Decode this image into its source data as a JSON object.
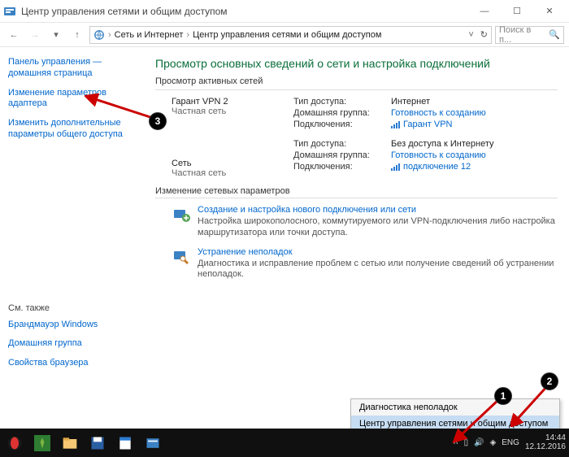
{
  "window": {
    "title": "Центр управления сетями и общим доступом",
    "min": "—",
    "max": "☐",
    "close": "✕"
  },
  "nav": {
    "back": "←",
    "forward": "→",
    "up": "↑",
    "root": "Сеть и Интернет",
    "sep": "›",
    "here": "Центр управления сетями и общим доступом",
    "refresh": "↻",
    "search_placeholder": "Поиск в п..."
  },
  "sidebar": {
    "home": "Панель управления — домашняя страница",
    "adapter": "Изменение параметров адаптера",
    "advshare": "Изменить дополнительные параметры общего доступа",
    "seealso": "См. также",
    "firewall": "Брандмауэр Windows",
    "homegroup": "Домашняя группа",
    "browser": "Свойства браузера"
  },
  "main": {
    "heading": "Просмотр основных сведений о сети и настройка подключений",
    "active_label": "Просмотр активных сетей",
    "change_label": "Изменение сетевых параметров",
    "nets": [
      {
        "name": "Гарант VPN  2",
        "kind": "Частная сеть",
        "kv": {
          "access_k": "Тип доступа:",
          "access_v": "Интернет",
          "hg_k": "Домашняя группа:",
          "hg_v": "Готовность к созданию",
          "conn_k": "Подключения:",
          "conn_v": "Гарант VPN"
        }
      },
      {
        "name": "Сеть",
        "kind": "Частная сеть",
        "kv": {
          "access_k": "Тип доступа:",
          "access_v": "Без доступа к Интернету",
          "hg_k": "Домашняя группа:",
          "hg_v": "Готовность к созданию",
          "conn_k": "Подключения:",
          "conn_v": "подключение 12"
        }
      }
    ],
    "tasks": {
      "new_title": "Создание и настройка нового подключения или сети",
      "new_desc": "Настройка широкополосного, коммутируемого или VPN-подключения либо настройка маршрутизатора или точки доступа.",
      "diag_title": "Устранение неполадок",
      "diag_desc": "Диагностика и исправление проблем с сетью или получение сведений об устранении неполадок."
    }
  },
  "ctx": {
    "diag": "Диагностика неполадок",
    "center": "Центр управления сетями и общим доступом"
  },
  "tray": {
    "lang": "ENG",
    "time": "14:44",
    "date": "12.12.2016"
  },
  "annot": {
    "b1": "1",
    "b2": "2",
    "b3": "3"
  }
}
